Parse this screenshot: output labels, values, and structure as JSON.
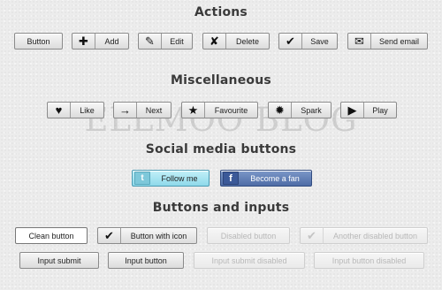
{
  "watermark": "ELLMOO BLOG",
  "sections": {
    "actions": "Actions",
    "misc": "Miscellaneous",
    "social": "Social media buttons",
    "inputs": "Buttons and inputs"
  },
  "actions": {
    "button": "Button",
    "add": "Add",
    "edit": "Edit",
    "delete": "Delete",
    "save": "Save",
    "send_email": "Send email"
  },
  "misc": {
    "like": "Like",
    "next": "Next",
    "favourite": "Favourite",
    "spark": "Spark",
    "play": "Play"
  },
  "social": {
    "follow": "Follow me",
    "fan": "Become a fan",
    "twitter_glyph": "t",
    "facebook_glyph": "f"
  },
  "inputs": {
    "clean_button": "Clean button",
    "button_with_icon": "Button with icon",
    "disabled_button": "Disabled button",
    "another_disabled": "Another disabled button",
    "input_submit": "Input submit",
    "input_button": "Input button",
    "input_submit_disabled": "Input submit disabled",
    "input_button_disabled": "Input button disabled"
  },
  "icons": {
    "plus": "plus-icon",
    "pencil": "pencil-icon",
    "delete": "x-icon",
    "save": "checkmark-icon",
    "email": "envelope-icon",
    "heart": "heart-icon",
    "arrow": "arrow-right-icon",
    "star": "star-icon",
    "spark": "spark-icon",
    "play": "play-icon"
  },
  "colors": {
    "background": "#ececec",
    "heading": "#3a3a3a",
    "twitter": "#8ed9ea",
    "facebook": "#4e6ca6",
    "disabled_text": "#b8b8b8"
  }
}
